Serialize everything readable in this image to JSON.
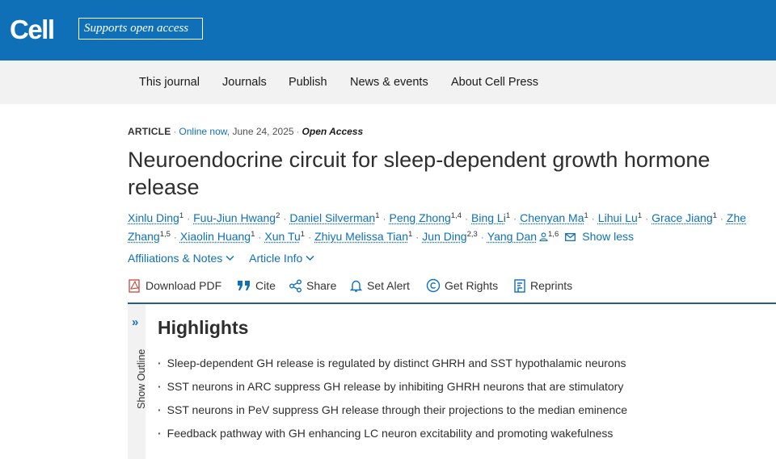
{
  "header": {
    "logo": "Cell",
    "open_access_badge": "Supports open access",
    "brand_color": "#0f70b7"
  },
  "nav": {
    "items": [
      "This journal",
      "Journals",
      "Publish",
      "News & events",
      "About Cell Press"
    ]
  },
  "article": {
    "type": "ARTICLE",
    "online": "Online now,",
    "date": "June 24, 2025",
    "access": "Open Access",
    "title": "Neuroendocrine circuit for sleep-dependent growth hormone release",
    "authors": [
      {
        "name": "Xinlu Ding",
        "sup": "1"
      },
      {
        "name": "Fuu-Jiun Hwang",
        "sup": "2"
      },
      {
        "name": "Daniel Silverman",
        "sup": "1"
      },
      {
        "name": "Peng Zhong",
        "sup": "1,4"
      },
      {
        "name": "Bing Li",
        "sup": "1"
      },
      {
        "name": "Chenyan Ma",
        "sup": "1"
      },
      {
        "name": "Lihui Lu",
        "sup": "1"
      },
      {
        "name": "Grace Jiang",
        "sup": "1"
      },
      {
        "name": "Zhe Zhang",
        "sup": "1,5"
      },
      {
        "name": "Xiaolin Huang",
        "sup": "1"
      },
      {
        "name": "Xun Tu",
        "sup": "1"
      },
      {
        "name": "Zhiyu Melissa Tian",
        "sup": "1"
      },
      {
        "name": "Jun Ding",
        "sup": "2,3"
      },
      {
        "name": "Yang Dan",
        "sup": "1,6"
      }
    ],
    "show_less": "Show less",
    "affiliations_link": "Affiliations & Notes",
    "article_info_link": "Article Info"
  },
  "tools": {
    "download_pdf": "Download PDF",
    "cite": "Cite",
    "share": "Share",
    "set_alert": "Set Alert",
    "get_rights": "Get Rights",
    "reprints": "Reprints"
  },
  "outline": {
    "label": "Show Outline"
  },
  "highlights": {
    "title": "Highlights",
    "items": [
      "Sleep-dependent GH release is regulated by distinct GHRH and SST hypothalamic neurons",
      "SST neurons in ARC suppress GH release by inhibiting GHRH neurons that are stimulatory",
      "SST neurons in PeV suppress GH release through their projections to the median eminence",
      "Feedback pathway with GH enhancing LC neuron excitability and promoting wakefulness"
    ]
  }
}
